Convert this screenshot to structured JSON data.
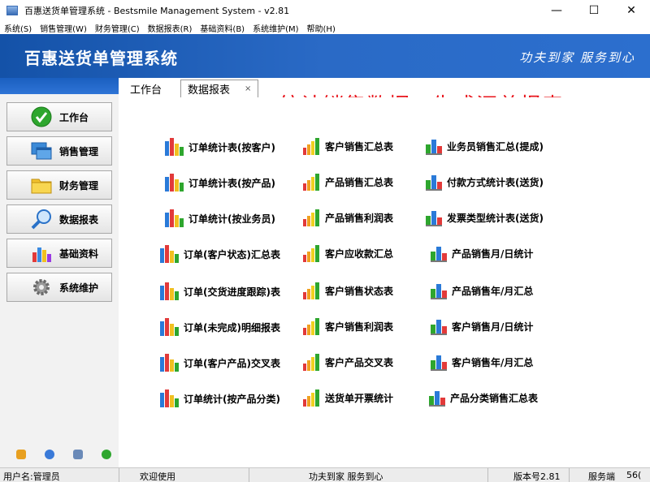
{
  "window": {
    "title": "百惠送货单管理系统 - Bestsmile Management System - v2.81",
    "minimize": "—",
    "maximize": "☐",
    "close": "✕"
  },
  "menu": [
    "系统(S)",
    "销售管理(W)",
    "财务管理(C)",
    "数据报表(R)",
    "基础资料(B)",
    "系统维护(M)",
    "帮助(H)"
  ],
  "banner": {
    "title": "百惠送货单管理系统",
    "slogan": "功夫到家 服务到心"
  },
  "nav": [
    {
      "label": "工作台",
      "icon": "check-circle-icon"
    },
    {
      "label": "销售管理",
      "icon": "windows-icon"
    },
    {
      "label": "财务管理",
      "icon": "folder-icon"
    },
    {
      "label": "数据报表",
      "icon": "magnifier-icon"
    },
    {
      "label": "基础资料",
      "icon": "palette-icon"
    },
    {
      "label": "系统维护",
      "icon": "gear-icon"
    }
  ],
  "tabs": {
    "home": "工作台",
    "reports": "数据报表",
    "close": "×"
  },
  "headline": "统计销售数据，生成汇总报表",
  "reports": {
    "col1": [
      "订单统计表(按客户)",
      "订单统计表(按产品)",
      "订单统计(按业务员)",
      "订单(客户状态)汇总表",
      "订单(交货进度跟踪)表",
      "订单(未完成)明细报表",
      "订单(客户产品)交叉表",
      "订单统计(按产品分类)"
    ],
    "col2": [
      "客户销售汇总表",
      "产品销售汇总表",
      "产品销售利润表",
      "客户应收款汇总",
      "客户销售状态表",
      "客户销售利润表",
      "客户产品交叉表",
      "送货单开票统计"
    ],
    "col3": [
      "业务员销售汇总(提成)",
      "付款方式统计表(送货)",
      "发票类型统计表(送货)",
      "产品销售月/日统计",
      "产品销售年/月汇总",
      "客户销售月/日统计",
      "客户销售年/月汇总",
      "产品分类销售汇总表"
    ]
  },
  "status": {
    "user": "用户名:管理员",
    "welcome": "欢迎使用",
    "slogan": "功夫到家 服务到心",
    "version": "版本号2.81",
    "server": "服务端",
    "server_val": "56("
  }
}
